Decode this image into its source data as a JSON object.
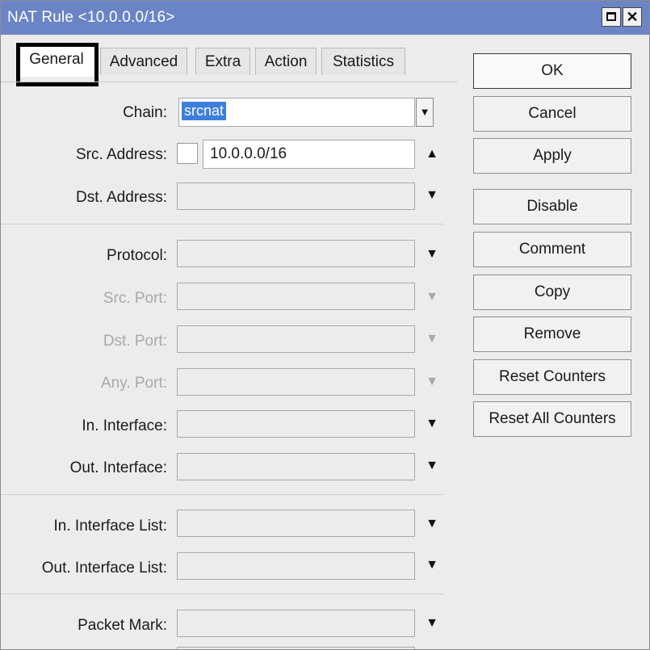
{
  "window": {
    "title": "NAT Rule <10.0.0.0/16>",
    "maximize_icon": "maximize-icon",
    "close_glyph": "✕"
  },
  "tabs": [
    {
      "label": "General",
      "active": true
    },
    {
      "label": "Advanced",
      "active": false
    },
    {
      "label": "Extra",
      "active": false
    },
    {
      "label": "Action",
      "active": false
    },
    {
      "label": "Statistics",
      "active": false
    }
  ],
  "form": {
    "chain": {
      "label": "Chain:",
      "value": "srcnat",
      "combo_glyph": "▼"
    },
    "src_address": {
      "label": "Src. Address:",
      "value": "10.0.0.0/16",
      "arrow": "▲"
    },
    "dst_address": {
      "label": "Dst. Address:",
      "arrow": "▼"
    },
    "protocol": {
      "label": "Protocol:",
      "arrow": "▼"
    },
    "src_port": {
      "label": "Src. Port:",
      "arrow": "▼"
    },
    "dst_port": {
      "label": "Dst. Port:",
      "arrow": "▼"
    },
    "any_port": {
      "label": "Any. Port:",
      "arrow": "▼"
    },
    "in_interface": {
      "label": "In. Interface:",
      "arrow": "▼"
    },
    "out_interface": {
      "label": "Out. Interface:",
      "arrow": "▼"
    },
    "in_interface_list": {
      "label": "In. Interface List:",
      "arrow": "▼"
    },
    "out_interface_list": {
      "label": "Out. Interface List:",
      "arrow": "▼"
    },
    "packet_mark": {
      "label": "Packet Mark:",
      "arrow": "▼"
    }
  },
  "buttons": {
    "ok": "OK",
    "cancel": "Cancel",
    "apply": "Apply",
    "disable": "Disable",
    "comment": "Comment",
    "copy": "Copy",
    "remove": "Remove",
    "reset_counters": "Reset Counters",
    "reset_all_counters": "Reset All Counters"
  },
  "colors": {
    "titlebar": "#6a84c6",
    "selection": "#3d7fdb",
    "disabled_text": "#a9a9a9"
  }
}
